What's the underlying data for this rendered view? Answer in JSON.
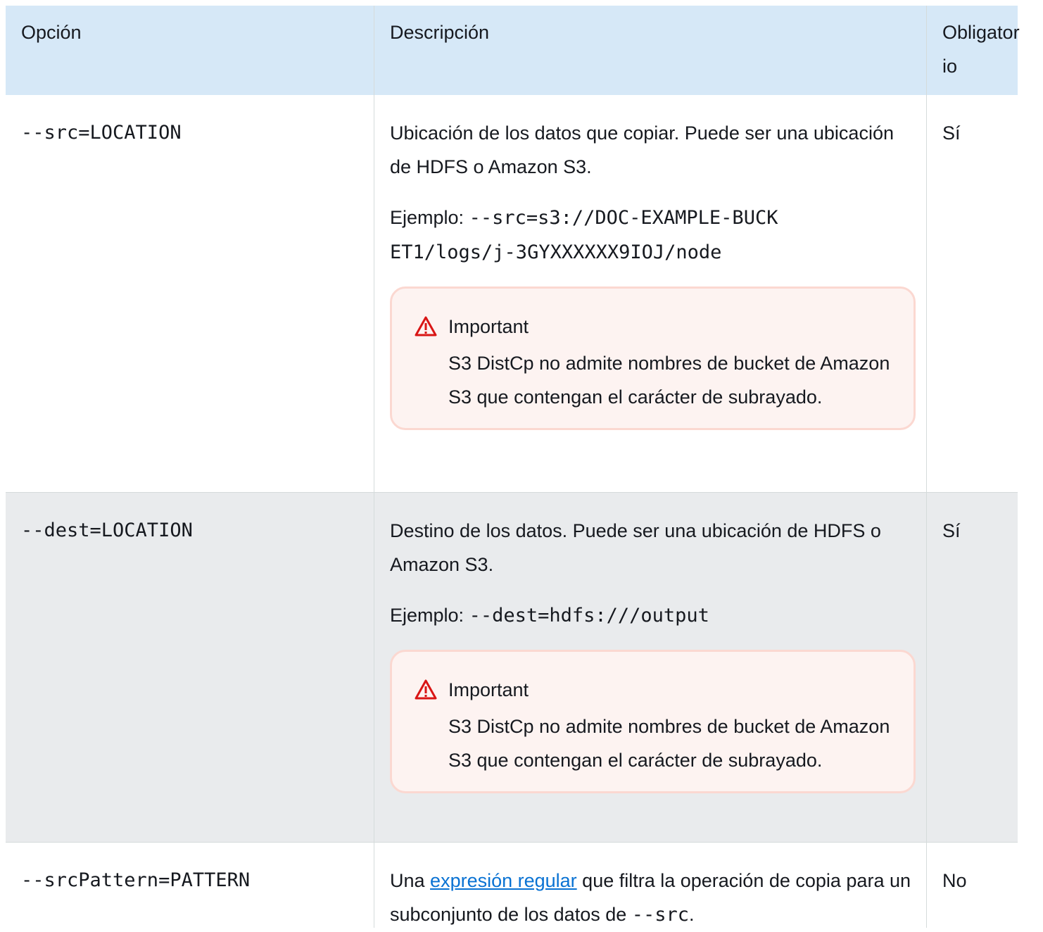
{
  "header": {
    "option": "Opción",
    "description": "Descripción",
    "required": "Obligator\nio"
  },
  "rows": [
    {
      "option": "--src=LOCATION",
      "description": "Ubicación de los datos que copiar. Puede ser una ubicación de HDFS o Amazon S3.",
      "example_label": "Ejemplo: ",
      "example_code": "--src=s3://DOC-EXAMPLE-BUCK\nET1/logs/j-3GYXXXXXX9IOJ/node",
      "alert_title": "Important",
      "alert_text": "S3 DistCp no admite nombres de bucket de Amazon S3 que contengan el carácter de subrayado.",
      "required": "Sí"
    },
    {
      "option": "--dest=LOCATION",
      "description": "Destino de los datos. Puede ser una ubicación de HDFS o Amazon S3.",
      "example_label": "Ejemplo: ",
      "example_code": "--dest=hdfs:///output",
      "alert_title": "Important",
      "alert_text": "S3 DistCp no admite nombres de bucket de Amazon S3 que contengan el carácter de subrayado.",
      "required": "Sí"
    },
    {
      "option": "--srcPattern=PATTERN",
      "description_before": "Una ",
      "description_link": "expresión regular",
      "description_after": " que filtra la operación de copia para un subconjunto de los datos de ",
      "description_code": "--src",
      "description_end": ".",
      "required": "No"
    }
  ],
  "icons": {
    "warning": "warning-triangle-icon"
  },
  "colors": {
    "header_bg": "#d6e8f7",
    "alt_row_bg": "#e9ebed",
    "alert_bg": "#fdf3f1",
    "alert_border": "#fbd8d1",
    "warning_icon": "#d91515",
    "link": "#0972d3"
  }
}
